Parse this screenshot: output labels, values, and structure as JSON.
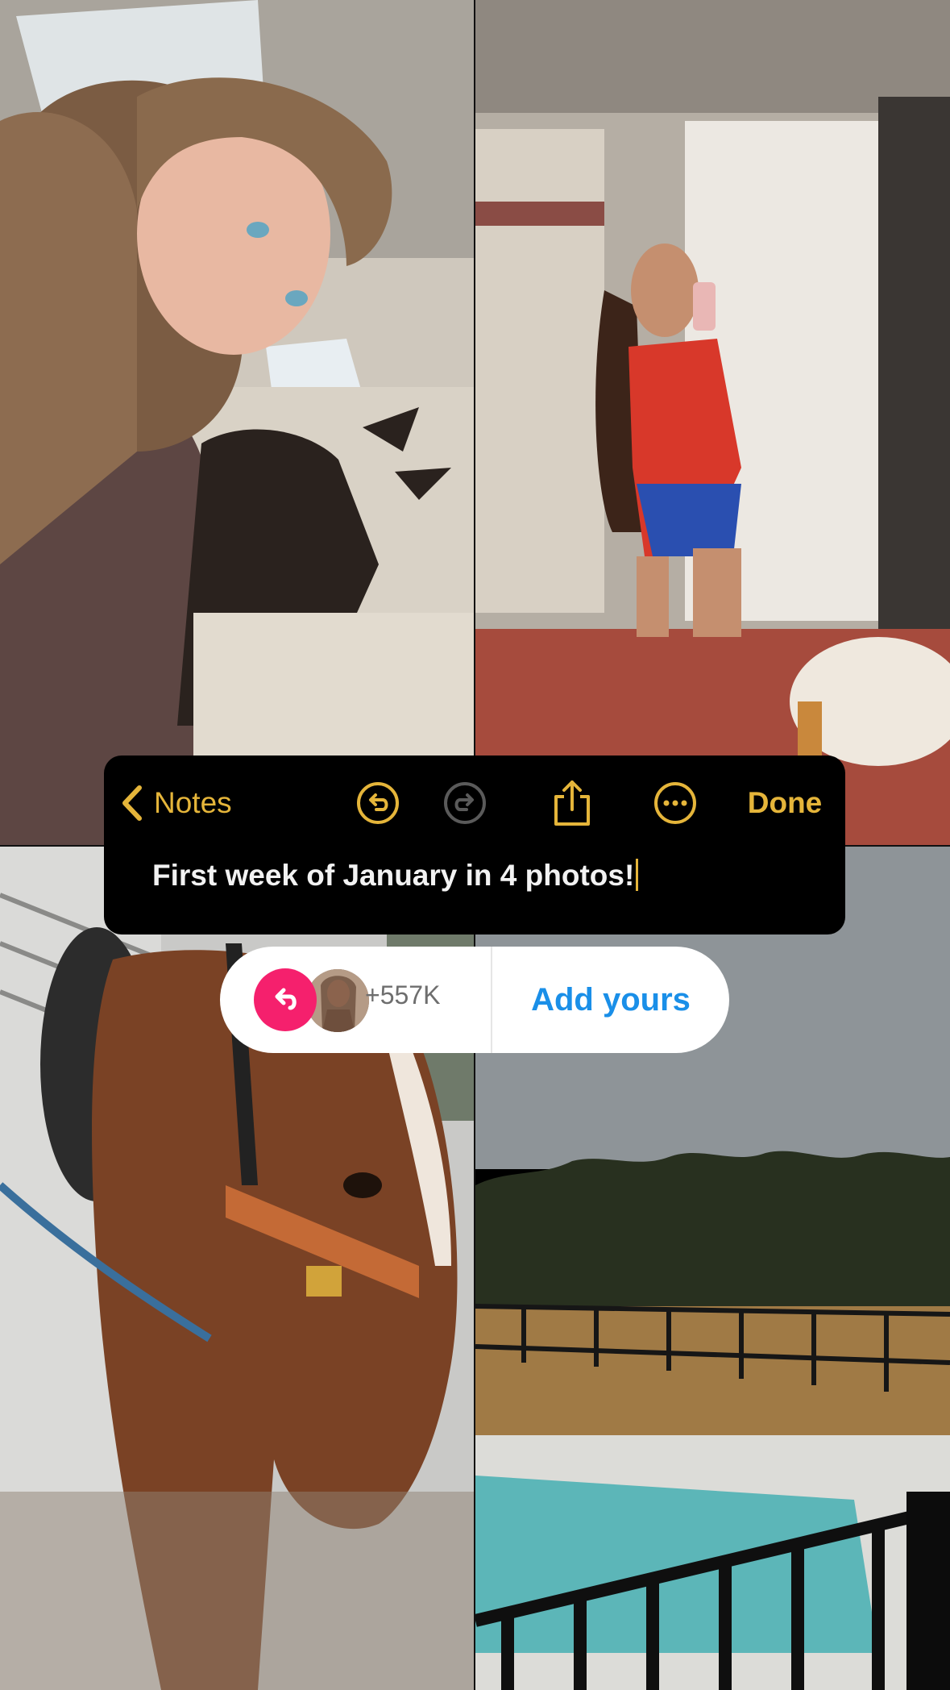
{
  "notes_toolbar": {
    "back_label": "Notes",
    "done_label": "Done",
    "accent_color": "#e5b53a",
    "icons": [
      "chevron-left-icon",
      "undo-icon",
      "redo-icon",
      "share-icon",
      "more-icon"
    ]
  },
  "note": {
    "text": "First week of January in 4 photos!"
  },
  "add_yours": {
    "count": "+557K",
    "cta_label": "Add yours",
    "accent_color": "#f5206d",
    "cta_color": "#1a8fe8"
  }
}
